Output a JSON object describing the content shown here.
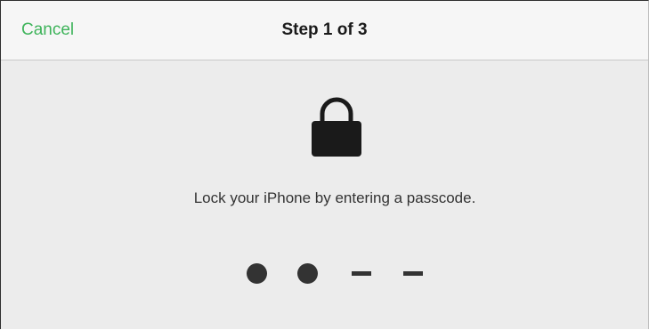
{
  "navbar": {
    "cancel_label": "Cancel",
    "title": "Step 1 of 3"
  },
  "main": {
    "lock_icon": "lock-icon",
    "message": "Lock your iPhone by entering a passcode.",
    "passcode": {
      "length": 4,
      "entered": 2
    }
  },
  "colors": {
    "accent": "#3fb45b",
    "background": "#ececec",
    "navbar": "#f6f6f6",
    "text": "#1a1a1a"
  }
}
